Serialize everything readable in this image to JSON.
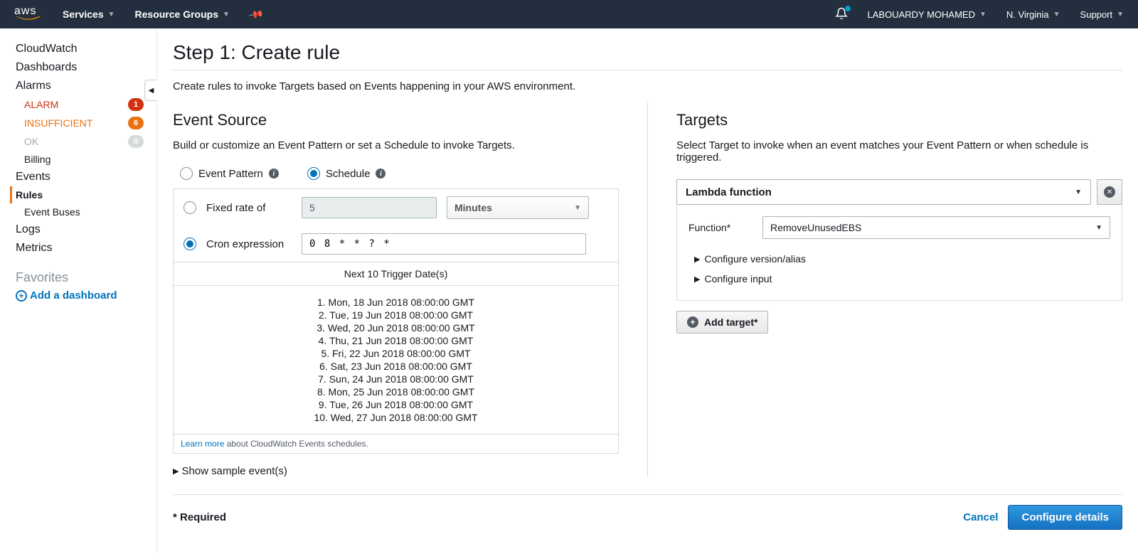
{
  "header": {
    "logo": "aws",
    "services": "Services",
    "resource_groups": "Resource Groups",
    "user": "LABOUARDY MOHAMED",
    "region": "N. Virginia",
    "support": "Support"
  },
  "sidebar": {
    "cloudwatch": "CloudWatch",
    "dashboards": "Dashboards",
    "alarms": "Alarms",
    "alarm_red": "ALARM",
    "alarm_red_count": "1",
    "insufficient": "INSUFFICIENT",
    "insufficient_count": "6",
    "ok": "OK",
    "ok_count": "0",
    "billing": "Billing",
    "events": "Events",
    "rules": "Rules",
    "event_buses": "Event Buses",
    "logs": "Logs",
    "metrics": "Metrics",
    "favorites": "Favorites",
    "add_dashboard": "Add a dashboard"
  },
  "page": {
    "title": "Step 1: Create rule",
    "subtitle": "Create rules to invoke Targets based on Events happening in your AWS environment."
  },
  "event_source": {
    "heading": "Event Source",
    "desc": "Build or customize an Event Pattern or set a Schedule to invoke Targets.",
    "event_pattern": "Event Pattern",
    "schedule": "Schedule",
    "fixed_rate": "Fixed rate of",
    "fixed_rate_value": "5",
    "fixed_rate_unit": "Minutes",
    "cron_expression": "Cron expression",
    "cron_value": "0 8 * * ? *",
    "trigger_header": "Next 10 Trigger Date(s)",
    "triggers": [
      "1. Mon, 18 Jun 2018 08:00:00 GMT",
      "2. Tue, 19 Jun 2018 08:00:00 GMT",
      "3. Wed, 20 Jun 2018 08:00:00 GMT",
      "4. Thu, 21 Jun 2018 08:00:00 GMT",
      "5. Fri, 22 Jun 2018 08:00:00 GMT",
      "6. Sat, 23 Jun 2018 08:00:00 GMT",
      "7. Sun, 24 Jun 2018 08:00:00 GMT",
      "8. Mon, 25 Jun 2018 08:00:00 GMT",
      "9. Tue, 26 Jun 2018 08:00:00 GMT",
      "10. Wed, 27 Jun 2018 08:00:00 GMT"
    ],
    "learn_more": "Learn more",
    "learn_more_text": " about CloudWatch Events schedules.",
    "show_sample": "Show sample event(s)"
  },
  "targets": {
    "heading": "Targets",
    "desc": "Select Target to invoke when an event matches your Event Pattern or when schedule is triggered.",
    "target_type": "Lambda function",
    "function_label": "Function*",
    "function_value": "RemoveUnusedEBS",
    "configure_version": "Configure version/alias",
    "configure_input": "Configure input",
    "add_target": "Add target*"
  },
  "footer": {
    "required": "* Required",
    "cancel": "Cancel",
    "configure": "Configure details"
  }
}
